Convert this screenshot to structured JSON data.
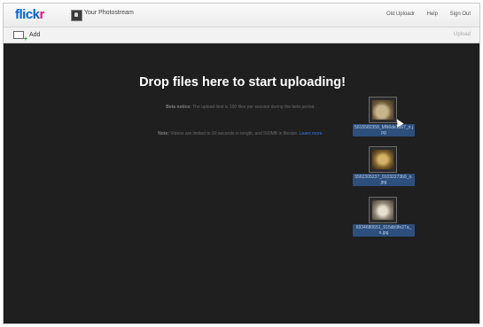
{
  "header": {
    "logo_flick": "flick",
    "logo_r": "r",
    "photostream_label": "Your Photostream",
    "links": [
      "Old Uploadr",
      "Help",
      "Sign Out"
    ]
  },
  "toolbar": {
    "add_label": "Add",
    "upload_label": "Upload"
  },
  "dropzone": {
    "headline": "Drop files here to start uploading!",
    "beta_label": "Beta notice:",
    "beta_text": " The upload limit is 100 files per session during the beta period.",
    "note_label": "Note:",
    "note_text": " Videos are limited to 90 seconds in length, and 500MB in filesize. ",
    "learn_more": "Learn more."
  },
  "files": [
    {
      "name": "5615582358_MN6de1d67_n.jpg"
    },
    {
      "name": "5562305237_01032273b9_n.jpg"
    },
    {
      "name": "6934680651_915db9fe27a_n.jpg"
    }
  ],
  "colors": {
    "logo_blue": "#0063dc",
    "logo_pink": "#ff0084",
    "background": "#1f1f1f",
    "caption_bg": "#2d4f7c"
  }
}
